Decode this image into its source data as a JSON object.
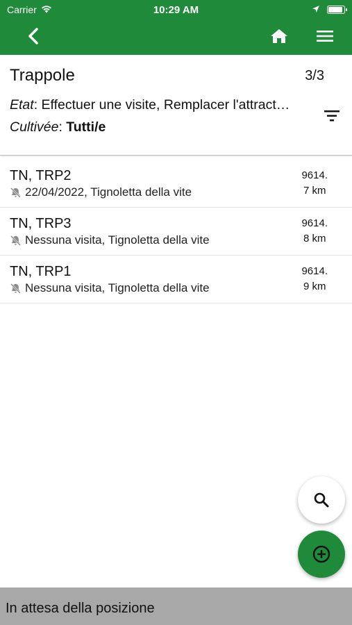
{
  "status_bar": {
    "carrier": "Carrier",
    "time": "10:29 AM",
    "battery_level": 0.9
  },
  "navbar": {
    "back_icon": "chevron-left-icon",
    "home_icon": "home-icon",
    "menu_icon": "hamburger-menu-icon"
  },
  "header": {
    "title": "Trappole",
    "count": "3/3",
    "filters": [
      {
        "label": "Etat",
        "value": ": Effectuer une visite, Remplacer l'attract…"
      },
      {
        "label": "Cultivée",
        "sep": ": ",
        "value": "Tutti/e"
      }
    ],
    "filter_icon": "filter-icon"
  },
  "traps": [
    {
      "name": "TN, TRP2",
      "detail": "22/04/2022, Tignoletta della vite",
      "distance_line1": "9614.",
      "distance_line2": "7 km"
    },
    {
      "name": "TN, TRP3",
      "detail": "Nessuna visita, Tignoletta della vite",
      "distance_line1": "9614.",
      "distance_line2": "8 km"
    },
    {
      "name": "TN, TRP1",
      "detail": "Nessuna visita, Tignoletta della vite",
      "distance_line1": "9614.",
      "distance_line2": "9 km"
    }
  ],
  "fab": {
    "search_icon": "search-icon",
    "add_icon": "add-circle-icon"
  },
  "bottom_bar": {
    "message": "In attesa della posizione"
  },
  "colors": {
    "primary": "#1f8a3a",
    "bottom_bar": "#a8a8a8"
  }
}
